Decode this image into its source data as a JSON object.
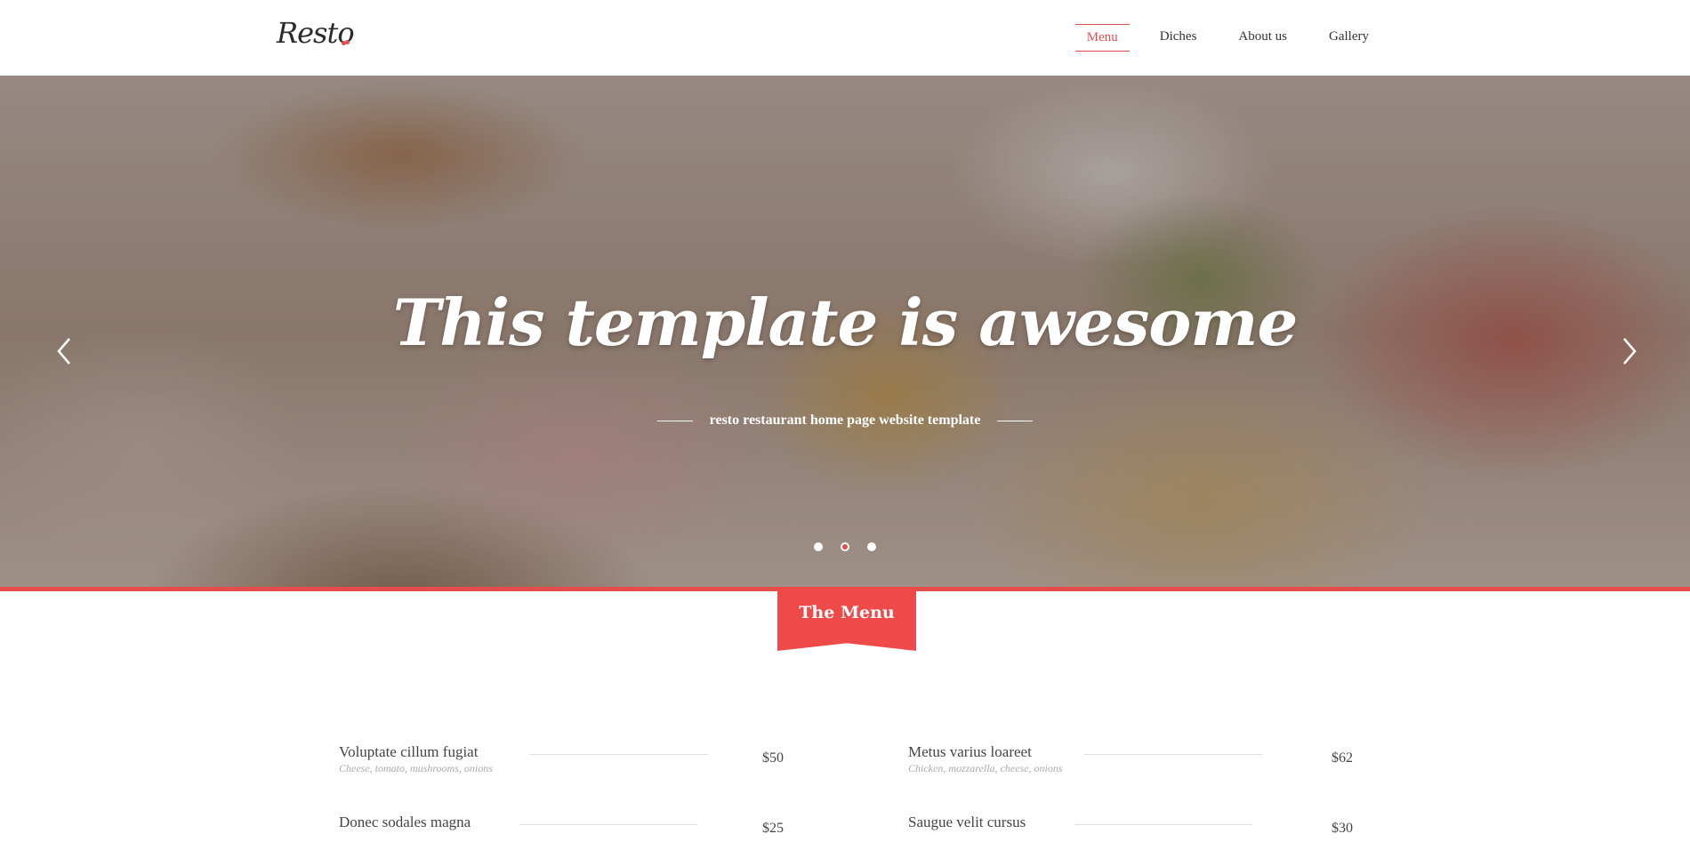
{
  "header": {
    "logo": "Resto",
    "nav": [
      "Menu",
      "Diches",
      "About us",
      "Gallery"
    ],
    "active_nav": "Menu"
  },
  "hero": {
    "title": "This template is awesome",
    "subtitle": "resto restaurant home page website template",
    "prev_icon": "chevron-left-icon",
    "next_icon": "chevron-right-icon",
    "slides": 3,
    "active_slide": 2
  },
  "menu_section": {
    "title": "The Menu",
    "items": [
      {
        "name": "Voluptate cillum fugiat",
        "desc": "Cheese, tomato, mushrooms, onions",
        "price": "$50"
      },
      {
        "name": "Metus varius loareet",
        "desc": "Chicken, mozzarella, cheese, onions",
        "price": "$62"
      },
      {
        "name": "Donec sodales magna",
        "desc": "",
        "price": "$25"
      },
      {
        "name": "Saugue velit cursus",
        "desc": "",
        "price": "$30"
      }
    ]
  },
  "colors": {
    "accent": "#e74c4c",
    "ribbon": "#ef4a4a",
    "text": "#333333"
  }
}
